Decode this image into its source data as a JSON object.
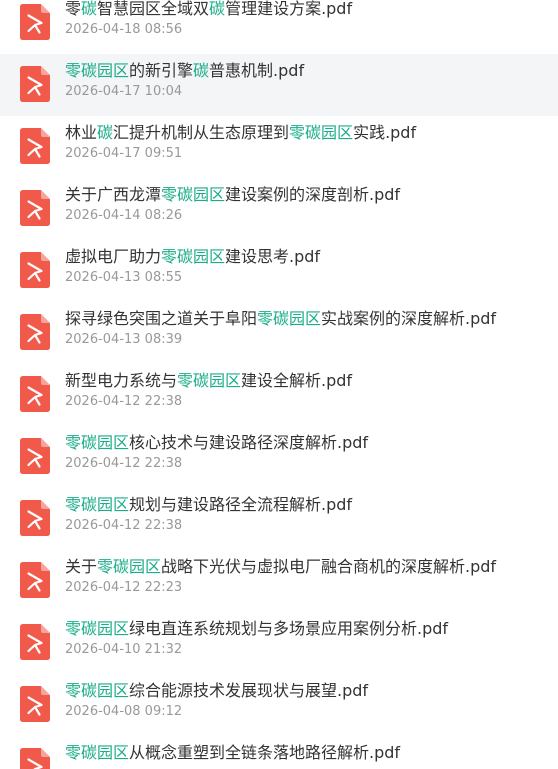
{
  "highlight_color": "#1aad8a",
  "icon": {
    "name": "pdf-file-icon",
    "color": "#f15a4a"
  },
  "files": [
    {
      "title": [
        "零",
        "碳",
        "智慧园区全域双",
        "碳",
        "管理建设方案.pdf"
      ],
      "date": "2026-04-18 08:56"
    },
    {
      "title": [
        "",
        "零碳园区",
        "的新引擎",
        "碳",
        "普惠机制.pdf"
      ],
      "date": "2026-04-17 10:04",
      "hovered": true
    },
    {
      "title": [
        "林业",
        "碳",
        "汇提升机制从生态原理到",
        "零碳园区",
        "实践.pdf"
      ],
      "date": "2026-04-17 09:51"
    },
    {
      "title": [
        "关于广西龙潭",
        "零碳园区",
        "建设案例的深度剖析.pdf"
      ],
      "date": "2026-04-14 08:26"
    },
    {
      "title": [
        "虚拟电厂助力",
        "零碳园区",
        "建设思考.pdf"
      ],
      "date": "2026-04-13 08:55"
    },
    {
      "title": [
        "探寻绿色突围之道关于阜阳",
        "零碳园区",
        "实战案例的深度解析.pdf"
      ],
      "date": "2026-04-13 08:39"
    },
    {
      "title": [
        "新型电力系统与",
        "零碳园区",
        "建设全解析.pdf"
      ],
      "date": "2026-04-12 22:38"
    },
    {
      "title": [
        "",
        "零碳园区",
        "核心技术与建设路径深度解析.pdf"
      ],
      "date": "2026-04-12 22:38"
    },
    {
      "title": [
        "",
        "零碳园区",
        "规划与建设路径全流程解析.pdf"
      ],
      "date": "2026-04-12 22:38"
    },
    {
      "title": [
        "关于",
        "零碳园区",
        "战略下光伏与虚拟电厂融合商机的深度解析.pdf"
      ],
      "date": "2026-04-12 22:23"
    },
    {
      "title": [
        "",
        "零碳园区",
        "绿电直连系统规划与多场景应用案例分析.pdf"
      ],
      "date": "2026-04-10 21:32"
    },
    {
      "title": [
        "",
        "零碳园区",
        "综合能源技术发展现状与展望.pdf"
      ],
      "date": "2026-04-08 09:12"
    },
    {
      "title": [
        "",
        "零碳园区",
        "从概念重塑到全链条落地路径解析.pdf"
      ],
      "date": ""
    }
  ]
}
